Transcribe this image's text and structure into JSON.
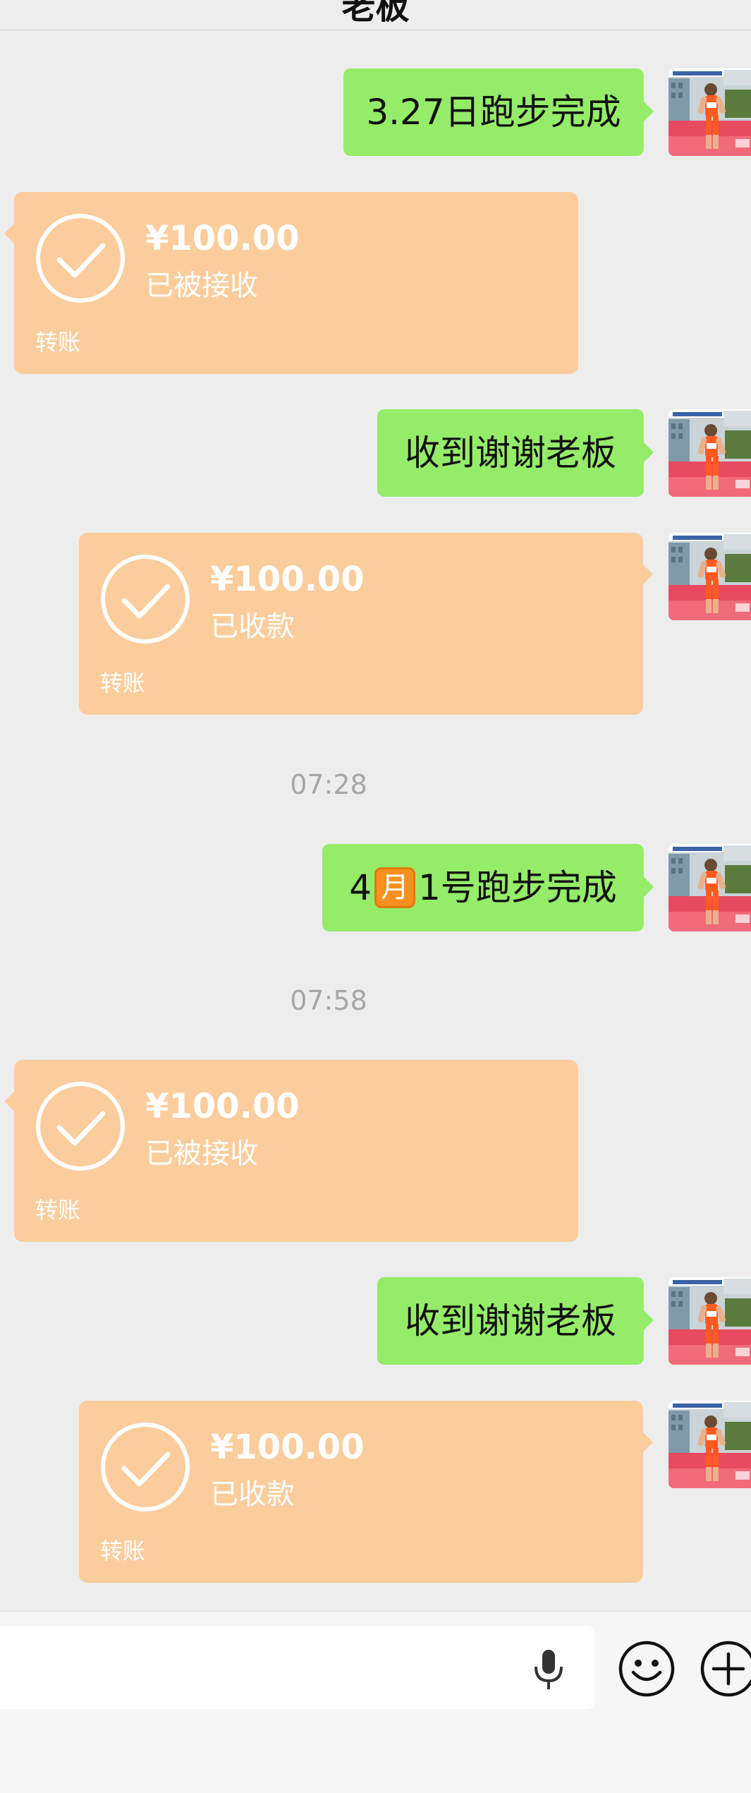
{
  "header": {
    "title": "老板"
  },
  "avatar_icon": "runner-photo-avatar",
  "colors": {
    "background": "#ededed",
    "sent_bubble": "#95ec69",
    "transfer_card": "#fbcd9d",
    "timestamp": "#a6a6a6"
  },
  "messages": [
    {
      "type": "text",
      "side": "right",
      "text": "3.27日跑步完成"
    },
    {
      "type": "transfer",
      "side": "left",
      "amount": "¥100.00",
      "status": "已被接收",
      "label": "转账"
    },
    {
      "type": "text",
      "side": "right",
      "text": "收到谢谢老板"
    },
    {
      "type": "transfer",
      "side": "right",
      "amount": "¥100.00",
      "status": "已收款",
      "label": "转账"
    },
    {
      "type": "time",
      "text": "07:28"
    },
    {
      "type": "text",
      "side": "right",
      "text_before": "4",
      "emoji": "月",
      "text_after": "1号跑步完成"
    },
    {
      "type": "time",
      "text": "07:58"
    },
    {
      "type": "transfer",
      "side": "left",
      "amount": "¥100.00",
      "status": "已被接收",
      "label": "转账"
    },
    {
      "type": "text",
      "side": "right",
      "text": "收到谢谢老板"
    },
    {
      "type": "transfer",
      "side": "right",
      "amount": "¥100.00",
      "status": "已收款",
      "label": "转账"
    }
  ],
  "input_bar": {
    "voice_icon": "microphone-icon",
    "emoji_icon": "smiley-icon",
    "more_icon": "plus-circle-icon"
  }
}
